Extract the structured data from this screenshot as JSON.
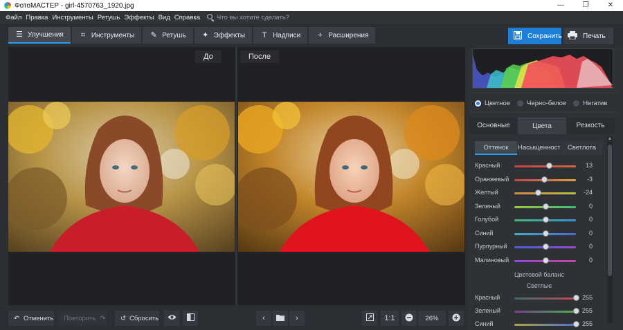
{
  "window": {
    "title": "ФотоМАСТЕР - girl-4570763_1920.jpg",
    "controls": [
      "—",
      "❐",
      "✕"
    ]
  },
  "menu": {
    "items": [
      "Файл",
      "Правка",
      "Инструменты",
      "Ретушь",
      "Эффекты",
      "Вид",
      "Справка"
    ],
    "search_placeholder": "Что вы хотите сделать?"
  },
  "tabs": [
    {
      "label": "Улучшения",
      "icon": "sliders-icon",
      "glyph": "☰",
      "active": true
    },
    {
      "label": "Инструменты",
      "icon": "crop-icon",
      "glyph": "⌗"
    },
    {
      "label": "Ретушь",
      "icon": "brush-icon",
      "glyph": "✎"
    },
    {
      "label": "Эффекты",
      "icon": "magic-wand-icon",
      "glyph": "✦"
    },
    {
      "label": "Надписи",
      "icon": "text-icon",
      "glyph": "T"
    },
    {
      "label": "Расширения",
      "icon": "plus-icon",
      "glyph": "+"
    }
  ],
  "actions": {
    "save_label": "Сохранить",
    "print_label": "Печать"
  },
  "preview": {
    "before_label": "До",
    "after_label": "После"
  },
  "bottom": {
    "undo_label": "Отменить",
    "redo_label": "Повторить",
    "reset_label": "Сбросить",
    "ratio_label": "1:1",
    "zoom_value": "26%"
  },
  "panel": {
    "color_modes": [
      {
        "label": "Цветное",
        "checked": true
      },
      {
        "label": "Черно-белое",
        "checked": false
      },
      {
        "label": "Негатив",
        "checked": false
      }
    ],
    "main_tabs": [
      "Основные",
      "Цвета",
      "Резкость"
    ],
    "active_main_tab": 1,
    "sub_tabs": [
      "Оттенок",
      "Насыщенность",
      "Светлота"
    ],
    "active_sub_tab": 0,
    "hue_sliders": [
      {
        "name": "Красный",
        "value": 13,
        "min": -100,
        "max": 100,
        "colors": [
          "#c0424a",
          "#d46a3a"
        ]
      },
      {
        "name": "Оранжевый",
        "value": -3,
        "min": -100,
        "max": 100,
        "colors": [
          "#c0424a",
          "#d9a43a"
        ]
      },
      {
        "name": "Желтый",
        "value": -24,
        "min": -100,
        "max": 100,
        "colors": [
          "#d68a3a",
          "#b8c23c"
        ]
      },
      {
        "name": "Зеленый",
        "value": 0,
        "min": -100,
        "max": 100,
        "colors": [
          "#9cc43c",
          "#3fbf7a"
        ]
      },
      {
        "name": "Голубой",
        "value": 0,
        "min": -100,
        "max": 100,
        "colors": [
          "#3fbf7a",
          "#3b8fd6"
        ]
      },
      {
        "name": "Синий",
        "value": 0,
        "min": -100,
        "max": 100,
        "colors": [
          "#3fb0c8",
          "#4a62d6"
        ]
      },
      {
        "name": "Пурпурный",
        "value": 0,
        "min": -100,
        "max": 100,
        "colors": [
          "#4a62d6",
          "#9b4ad0"
        ]
      },
      {
        "name": "Малиновый",
        "value": 0,
        "min": -100,
        "max": 100,
        "colors": [
          "#8c4ad0",
          "#c8459a"
        ]
      }
    ],
    "balance_title": "Цветовой баланс",
    "balance_subtitle": "Светлые",
    "balance_sliders": [
      {
        "name": "Красный",
        "value": 255,
        "min": 0,
        "max": 255,
        "colors": [
          "#3a6f6f",
          "#c24a4a"
        ]
      },
      {
        "name": "Зеленый",
        "value": 255,
        "min": 0,
        "max": 255,
        "colors": [
          "#7a3f8a",
          "#4fb04f"
        ]
      },
      {
        "name": "Синий",
        "value": 255,
        "min": 0,
        "max": 255,
        "colors": [
          "#b5a23a",
          "#4a6fd6"
        ]
      }
    ]
  },
  "colors": {
    "accent": "#1f7fd6",
    "background": "#2b2e33",
    "canvas": "#1f2125"
  }
}
